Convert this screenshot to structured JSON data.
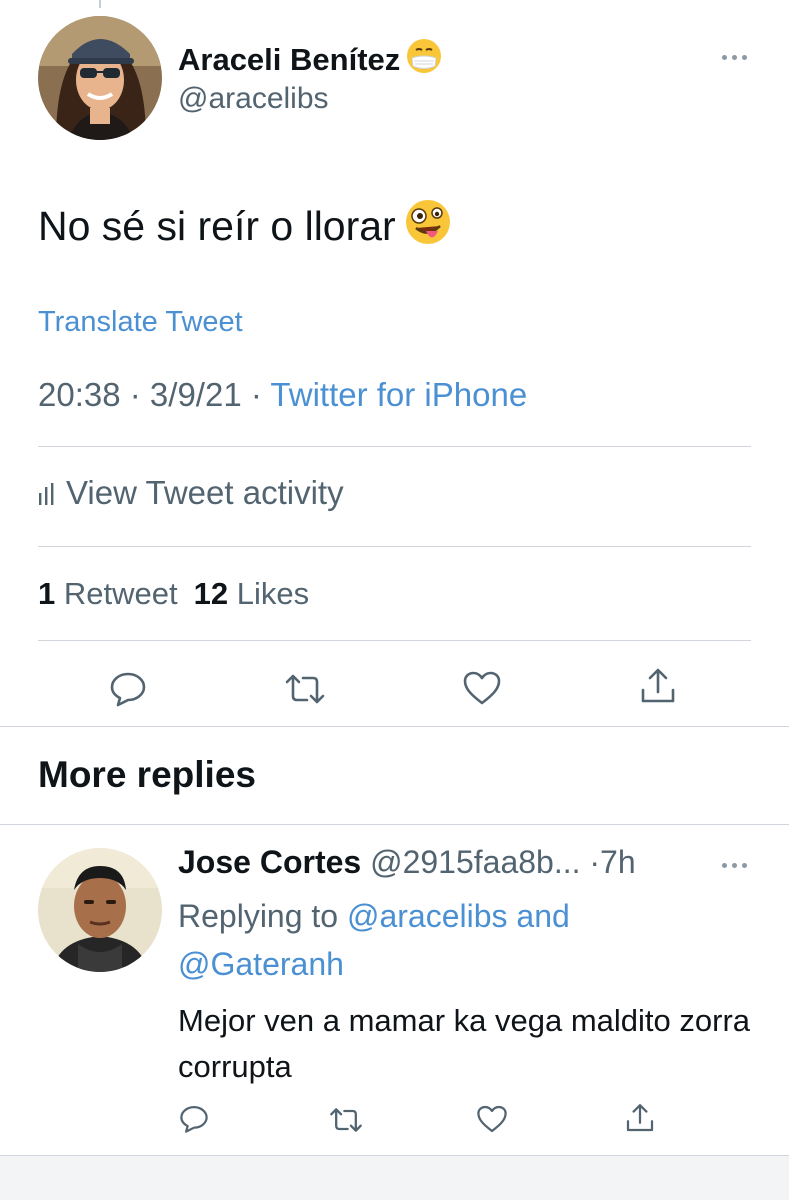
{
  "tweet": {
    "author_name": "Araceli Benítez",
    "author_handle": "@aracelibs",
    "text": "No sé si reír o llorar",
    "translate_label": "Translate Tweet",
    "time": "20:38",
    "date": "3/9/21",
    "separator": " · ",
    "source": "Twitter for iPhone",
    "activity_label": "View Tweet activity",
    "retweet_count": "1",
    "retweet_label": "Retweet",
    "like_count": "12",
    "like_label": "Likes"
  },
  "more_replies": {
    "title": "More replies"
  },
  "reply": {
    "name": "Jose Cortes",
    "handle": "@2915faa8b...",
    "age": "·7h",
    "replying_prefix": "Replying to ",
    "mention_1": "@aracelibs",
    "and_label": " and",
    "mention_2": "@Gateranh",
    "text": "Mejor ven a mamar ka vega maldito zorra corrupta"
  },
  "colors": {
    "link": "#4a90d2",
    "secondary_text": "#536471",
    "primary_text": "#0f1419",
    "divider": "#d0d6db",
    "icon": "#536471"
  },
  "icons": {
    "author_name_emoji": "face-with-medical-mask-icon",
    "tweet_emoji": "zany-face-icon",
    "activity": "bar-chart-icon",
    "reply": "reply-bubble-icon",
    "retweet": "retweet-icon",
    "like": "heart-icon",
    "share": "share-icon",
    "more": "more-dots-icon"
  }
}
